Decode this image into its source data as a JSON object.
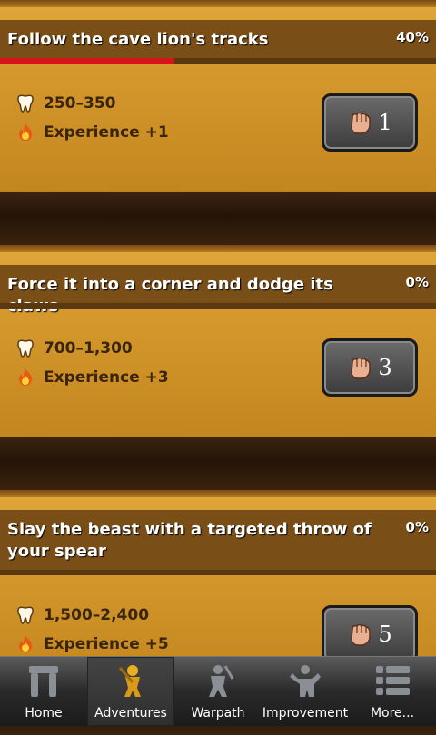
{
  "quests": [
    {
      "title": "Follow the cave lion's tracks",
      "percent": "40%",
      "progress": 0.4,
      "teeth": "250–350",
      "experience": "Experience +1",
      "energy": "1"
    },
    {
      "title": "Force it into a corner and dodge its claws",
      "percent": "0%",
      "progress": 0,
      "teeth": "700–1,300",
      "experience": "Experience +3",
      "energy": "3"
    },
    {
      "title": "Slay the beast with a targeted throw of your spear",
      "percent": "0%",
      "progress": 0,
      "teeth": "1,500–2,400",
      "experience": "Experience +5",
      "energy": "5"
    }
  ],
  "tabs": [
    {
      "label": "Home",
      "icon": "dolmen-icon",
      "active": false
    },
    {
      "label": "Adventures",
      "icon": "caveman-icon",
      "active": true
    },
    {
      "label": "Warpath",
      "icon": "warrior-icon",
      "active": false
    },
    {
      "label": "Improvement",
      "icon": "strongman-icon",
      "active": false
    },
    {
      "label": "More...",
      "icon": "list-icon",
      "active": false
    }
  ],
  "colors": {
    "progress": "#d8141a",
    "header": "#7a4f17",
    "plank": "#d69a2e",
    "button": "#4a4a4a"
  }
}
